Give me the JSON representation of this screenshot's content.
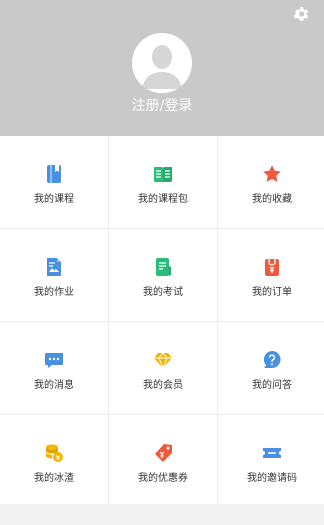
{
  "header": {
    "login_label": "注册/登录",
    "background": "#c9c9c9"
  },
  "menu": [
    {
      "label": "我的课程",
      "icon": "book-icon",
      "color": "#4a90e2"
    },
    {
      "label": "我的课程包",
      "icon": "open-book-icon",
      "color": "#2dbb7b"
    },
    {
      "label": "我的收藏",
      "icon": "star-icon",
      "color": "#f05a3c"
    },
    {
      "label": "我的作业",
      "icon": "document-image-icon",
      "color": "#4a90e2"
    },
    {
      "label": "我的考试",
      "icon": "exam-icon",
      "color": "#2dbb7b"
    },
    {
      "label": "我的订单",
      "icon": "order-bag-icon",
      "color": "#f05a3c"
    },
    {
      "label": "我的消息",
      "icon": "message-bubble-icon",
      "color": "#4a90e2"
    },
    {
      "label": "我的会员",
      "icon": "diamond-icon",
      "color": "#f4b400"
    },
    {
      "label": "我的问答",
      "icon": "question-bubble-icon",
      "color": "#4a90e2"
    },
    {
      "label": "我的冰渣",
      "icon": "coins-icon",
      "color": "#f4b400"
    },
    {
      "label": "我的优惠券",
      "icon": "coupon-tag-icon",
      "color": "#f05a3c"
    },
    {
      "label": "我的邀请码",
      "icon": "ticket-icon",
      "color": "#4a90e2"
    }
  ]
}
